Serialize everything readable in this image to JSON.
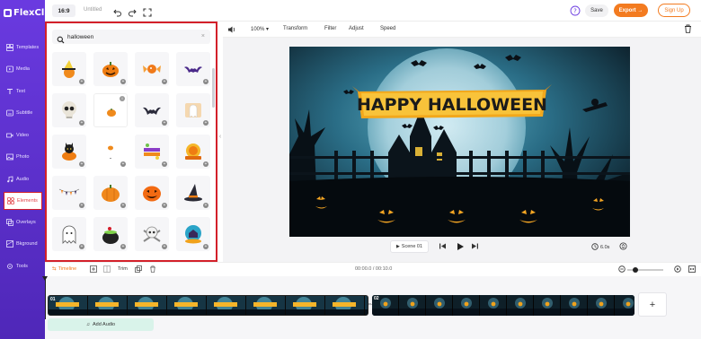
{
  "app": {
    "logo_text": "FlexClip"
  },
  "sidebar": {
    "items": [
      {
        "label": "Templates",
        "icon": "templates-icon"
      },
      {
        "label": "Media",
        "icon": "media-icon"
      },
      {
        "label": "Text",
        "icon": "text-icon"
      },
      {
        "label": "Subtitle",
        "icon": "subtitle-icon"
      },
      {
        "label": "Video",
        "icon": "video-icon"
      },
      {
        "label": "Photo",
        "icon": "photo-icon"
      },
      {
        "label": "Audio",
        "icon": "audio-icon"
      },
      {
        "label": "Elements",
        "icon": "elements-icon",
        "active": true
      },
      {
        "label": "Overlays",
        "icon": "overlays-icon"
      },
      {
        "label": "Bkground",
        "icon": "background-icon"
      },
      {
        "label": "Tools",
        "icon": "tools-icon"
      }
    ]
  },
  "topbar": {
    "ratio": "16:9",
    "project_title": "Untitled",
    "save_label": "Save",
    "export_label": "Export →",
    "signup_label": "Sign Up"
  },
  "panel": {
    "search_value": "halloween",
    "elements": [
      "witch-hat-pumpkin",
      "jack-o-lantern",
      "candy",
      "bat",
      "skull",
      "small-pumpkin",
      "bat-dark",
      "ghost-sign",
      "black-cat-pumpkin",
      "tiny-pumpkin",
      "happy-halloween-text",
      "halloween-badge",
      "garland",
      "orange-pumpkin",
      "smiling-pumpkin",
      "witch-hat",
      "ghost",
      "cauldron",
      "skull-crossbones",
      "haunted-house-globe"
    ]
  },
  "edit_toolbar": {
    "zoom": "100%",
    "transform_label": "Transform",
    "filter_label": "Filter",
    "adjust_label": "Adjust",
    "speed_label": "Speed"
  },
  "scene": {
    "banner_text": "HAPPY HALLOWEEN"
  },
  "player": {
    "scene_label": "Scene 01",
    "duration": "6.0s"
  },
  "timeline": {
    "label": "Timeline",
    "trim_label": "Trim",
    "time_display": "00:00.0 / 00:10.0",
    "zoom_level": 0.2,
    "clips": [
      {
        "number": "01"
      },
      {
        "number": "02"
      }
    ],
    "add_audio_label": "Add Audio"
  },
  "colors": {
    "sidebar": "#5b2fd0",
    "accent": "#f37b20",
    "highlight": "#d3202a"
  }
}
